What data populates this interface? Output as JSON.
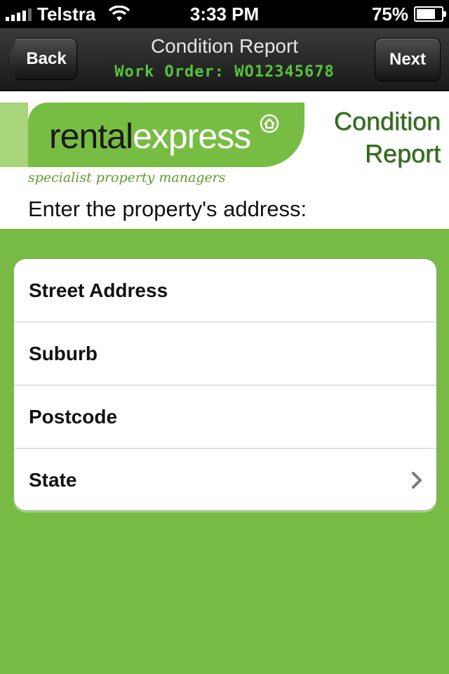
{
  "status_bar": {
    "carrier": "Telstra",
    "time": "3:33 PM",
    "battery": "75%",
    "battery_level": 0.75
  },
  "nav": {
    "back_label": "Back",
    "title": "Condition Report",
    "subtitle": "Work Order: WO12345678",
    "next_label": "Next"
  },
  "header": {
    "logo_rental": "rental",
    "logo_express": "express",
    "tagline": "specialist property managers",
    "report_title_line1": "Condition",
    "report_title_line2": "Report",
    "prompt": "Enter the property's address:"
  },
  "form": {
    "fields": [
      {
        "label": "Street Address"
      },
      {
        "label": "Suburb"
      },
      {
        "label": "Postcode"
      },
      {
        "label": "State"
      }
    ]
  },
  "colors": {
    "brand_green": "#77bb44",
    "title_green": "#2e6b16",
    "subtitle_green": "#55c43a"
  }
}
